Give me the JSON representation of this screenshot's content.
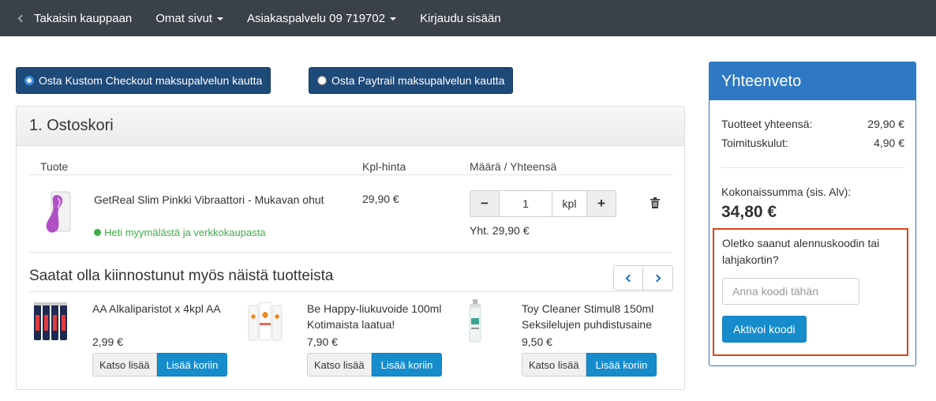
{
  "nav": {
    "back": "Takaisin kauppaan",
    "account": "Omat sivut",
    "support": "Asiakaspalvelu 09 719702",
    "login": "Kirjaudu sisään"
  },
  "payment": {
    "kustom": "Osta Kustom Checkout maksupalvelun kautta",
    "paytrail": "Osta Paytrail maksupalvelun kautta",
    "selected": "kustom"
  },
  "cart": {
    "title": "1. Ostoskori",
    "columns": {
      "product": "Tuote",
      "unit_price": "Kpl-hinta",
      "qty_total": "Määrä / Yhteensä"
    },
    "item": {
      "name": "GetReal Slim Pinkki Vibraattori - Mukavan ohut",
      "stock": "Heti myymälästä ja verkkokaupasta",
      "unit_price": "29,90 €",
      "quantity": "1",
      "unit": "kpl",
      "line_total": "Yht. 29,90 €"
    },
    "recommend_title": "Saatat olla kiinnostunut myös näistä tuotteista",
    "recommendations": [
      {
        "name": "AA Alkaliparistot x 4kpl AA",
        "price": "2,99 €",
        "more": "Katso lisää",
        "add": "Lisää koriin"
      },
      {
        "name": "Be Happy-liukuvoide 100ml Kotimaista laatua!",
        "price": "7,90 €",
        "more": "Katso lisää",
        "add": "Lisää koriin"
      },
      {
        "name": "Toy Cleaner Stimul8 150ml Seksilelujen puhdistusaine",
        "price": "9,50 €",
        "more": "Katso lisää",
        "add": "Lisää koriin"
      }
    ]
  },
  "summary": {
    "title": "Yhteenveto",
    "products_label": "Tuotteet yhteensä:",
    "products_value": "29,90 €",
    "shipping_label": "Toimituskulut:",
    "shipping_value": "4,90 €",
    "total_label": "Kokonaissumma (sis. Alv):",
    "total_value": "34,80 €",
    "coupon_question": "Oletko saanut alennuskoodin tai lahjakortin?",
    "coupon_placeholder": "Anna koodi tähän",
    "coupon_button": "Aktivoi koodi"
  },
  "colors": {
    "nav_bg": "#3a4149",
    "payment_btn": "#1e4a7a",
    "summary_head": "#2f79c4",
    "action_blue": "#168ccd",
    "stock_green": "#3fae49",
    "coupon_border": "#d9451b"
  },
  "icons": [
    "chevron-left-icon",
    "caret-down-icon",
    "radio-icon",
    "trash-icon",
    "chevron-right-icon"
  ]
}
